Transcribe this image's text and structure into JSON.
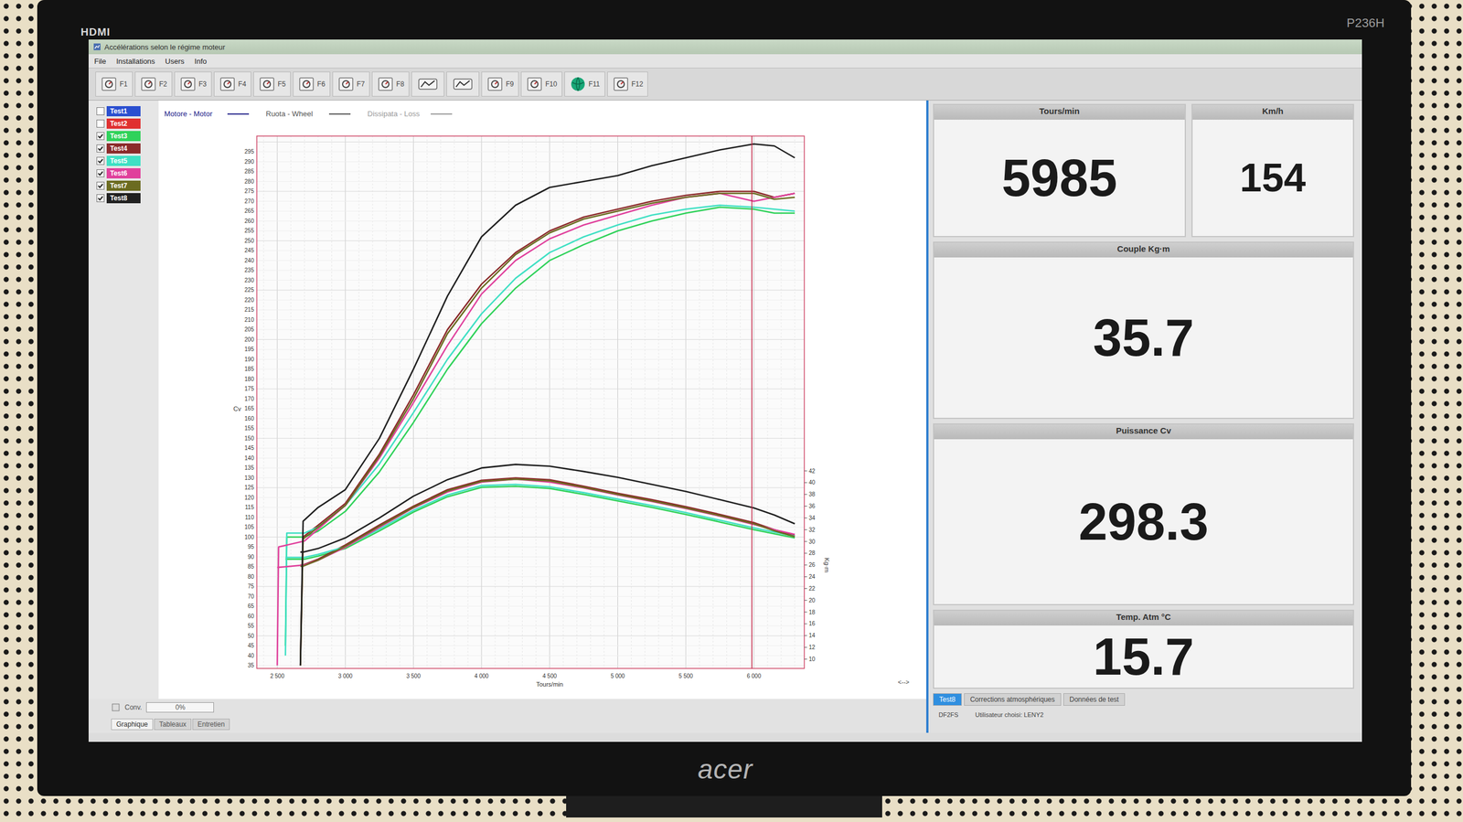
{
  "monitor": {
    "input": "HDMI",
    "model": "P236H",
    "brand": "acer"
  },
  "window": {
    "title": "Accélérations selon le régime moteur"
  },
  "menu": [
    "File",
    "Installations",
    "Users",
    "Info"
  ],
  "toolbar": [
    {
      "label": "F1",
      "kind": "labeled"
    },
    {
      "label": "F2",
      "kind": "labeled"
    },
    {
      "label": "F3",
      "kind": "labeled"
    },
    {
      "label": "F4",
      "kind": "labeled"
    },
    {
      "label": "F5",
      "kind": "labeled"
    },
    {
      "label": "F6",
      "kind": "labeled"
    },
    {
      "label": "F7",
      "kind": "labeled"
    },
    {
      "label": "F8",
      "kind": "labeled"
    },
    {
      "label": "",
      "kind": "icon"
    },
    {
      "label": "",
      "kind": "icon"
    },
    {
      "label": "F9",
      "kind": "labeled"
    },
    {
      "label": "F10",
      "kind": "labeled"
    },
    {
      "label": "F11",
      "kind": "globe"
    },
    {
      "label": "F12",
      "kind": "labeled"
    }
  ],
  "chart_legend": [
    {
      "label": "Motore - Motor",
      "color": "#23238a"
    },
    {
      "label": "Ruota - Wheel",
      "color": "#555555"
    },
    {
      "label": "Dissipata - Loss",
      "color": "#9a9a9a"
    }
  ],
  "tests": [
    {
      "label": "Test1",
      "checked": false,
      "color": "#2a4fd0",
      "rpm": [],
      "power": [],
      "torque": []
    },
    {
      "label": "Test2",
      "checked": false,
      "color": "#e03030",
      "rpm": [],
      "power": [],
      "torque": []
    },
    {
      "label": "Test3",
      "checked": true,
      "color": "#2fd25a",
      "rpm": [
        2560,
        2570,
        2700,
        2800,
        3000,
        3250,
        3500,
        3750,
        4000,
        4250,
        4500,
        4750,
        5000,
        5250,
        5500,
        5750,
        6000,
        6150,
        6300
      ],
      "power": [
        45,
        100,
        100,
        103,
        113,
        133,
        158,
        185,
        208,
        226,
        240,
        248,
        255,
        260,
        264,
        267,
        266,
        264,
        264
      ],
      "torque": [
        27,
        27,
        27,
        27.5,
        28.8,
        31.8,
        35,
        37.6,
        39.2,
        39.4,
        39,
        38,
        36.9,
        35.8,
        34.6,
        33.3,
        32,
        31.3,
        30.6
      ]
    },
    {
      "label": "Test4",
      "checked": true,
      "color": "#8b2a2a",
      "rpm": [
        2670,
        2690,
        2800,
        3000,
        3250,
        3500,
        3750,
        4000,
        4250,
        4500,
        4750,
        5000,
        5250,
        5500,
        5750,
        6000,
        6150,
        6300
      ],
      "power": [
        35,
        100,
        106,
        117,
        142,
        172,
        205,
        228,
        244,
        255,
        262,
        266,
        270,
        273,
        275,
        275,
        272,
        274
      ],
      "torque": [
        26,
        26,
        27,
        29.4,
        32.8,
        36,
        38.8,
        40.4,
        40.8,
        40.5,
        39.4,
        38.2,
        37.1,
        35.9,
        34.6,
        33.2,
        32,
        31
      ]
    },
    {
      "label": "Test5",
      "checked": true,
      "color": "#3fe0c4",
      "rpm": [
        2560,
        2570,
        2700,
        2800,
        3000,
        3250,
        3500,
        3750,
        4000,
        4250,
        4500,
        4750,
        5000,
        5250,
        5500,
        5750,
        6000,
        6150,
        6300
      ],
      "power": [
        40,
        102,
        102,
        105,
        116,
        137,
        163,
        190,
        213,
        231,
        244,
        252,
        258,
        263,
        266,
        268,
        267,
        266,
        265
      ],
      "torque": [
        27.3,
        27.3,
        27.3,
        27.8,
        29.1,
        32.1,
        35.3,
        37.9,
        39.5,
        39.7,
        39.3,
        38.3,
        37.2,
        36.1,
        34.9,
        33.6,
        32.3,
        31.6,
        30.9
      ]
    },
    {
      "label": "Test6",
      "checked": true,
      "color": "#e0409c",
      "rpm": [
        2500,
        2510,
        2700,
        2800,
        3000,
        3250,
        3500,
        3750,
        4000,
        4250,
        4500,
        4750,
        5000,
        5250,
        5500,
        5750,
        6000,
        6150,
        6300
      ],
      "power": [
        35,
        95,
        98,
        104,
        116,
        140,
        168,
        197,
        223,
        240,
        251,
        258,
        263,
        268,
        272,
        274,
        270,
        272,
        274
      ],
      "torque": [
        25.6,
        25.6,
        26,
        26.8,
        29,
        32.4,
        35.7,
        38.4,
        40.1,
        40.6,
        40.1,
        39.1,
        37.9,
        36.8,
        35.6,
        34.3,
        32.9,
        32,
        31.2
      ]
    },
    {
      "label": "Test7",
      "checked": true,
      "color": "#6b6b20",
      "rpm": [
        2670,
        2690,
        2800,
        3000,
        3250,
        3500,
        3750,
        4000,
        4250,
        4500,
        4750,
        5000,
        5250,
        5500,
        5750,
        6000,
        6150,
        6300
      ],
      "power": [
        35,
        99,
        105,
        116,
        141,
        170,
        203,
        226,
        243,
        254,
        261,
        265,
        269,
        272,
        274,
        274,
        271,
        272
      ],
      "torque": [
        25.8,
        25.8,
        26.8,
        29.2,
        32.6,
        35.8,
        38.6,
        40.2,
        40.6,
        40.3,
        39.2,
        38,
        36.9,
        35.7,
        34.4,
        33,
        31.8,
        30.8
      ]
    },
    {
      "label": "Test8",
      "checked": true,
      "color": "#202020",
      "rpm": [
        2670,
        2690,
        2800,
        3000,
        3250,
        3500,
        3750,
        4000,
        4250,
        4500,
        4750,
        5000,
        5250,
        5500,
        5750,
        6000,
        6150,
        6300
      ],
      "power": [
        35,
        108,
        115,
        124,
        150,
        185,
        222,
        252,
        268,
        277,
        280,
        283,
        288,
        292,
        296,
        299,
        298,
        292
      ],
      "torque": [
        28.2,
        28.2,
        28.8,
        30.6,
        34,
        37.7,
        40.5,
        42.5,
        43.1,
        42.8,
        41.9,
        40.9,
        39.7,
        38.5,
        37.1,
        35.7,
        34.5,
        33
      ]
    }
  ],
  "axes": {
    "power_label": "Cv",
    "power_ticks": [
      "295",
      "290",
      "285",
      "280",
      "275",
      "270",
      "265",
      "260",
      "255",
      "250",
      "245",
      "240",
      "235",
      "230",
      "225",
      "220",
      "215",
      "210",
      "205",
      "200",
      "195",
      "190",
      "185",
      "180",
      "175",
      "170",
      "165",
      "160",
      "155",
      "150",
      "145",
      "140",
      "135",
      "130",
      "125",
      "120",
      "115",
      "110",
      "105",
      "100",
      "95",
      "90",
      "85",
      "80",
      "75",
      "70",
      "65",
      "60",
      "55",
      "50",
      "45",
      "40",
      "35"
    ],
    "torque_label": "Kg·m",
    "torque_ticks": [
      "42",
      "40",
      "38",
      "36",
      "34",
      "32",
      "30",
      "28",
      "26",
      "24",
      "22",
      "20",
      "18",
      "16",
      "14",
      "12",
      "10"
    ],
    "rpm_label": "Tours/min",
    "rpm_ticks": [
      "2 500",
      "3 000",
      "3 500",
      "4 000",
      "4 500",
      "5 000",
      "5 500",
      "6 000"
    ]
  },
  "scroll": "<-->",
  "bottom_bar": {
    "conv_label": "Conv.",
    "conv_value": "0%",
    "tabs": [
      {
        "label": "Graphique",
        "selected": true
      },
      {
        "label": "Tableaux",
        "selected": false
      },
      {
        "label": "Entretien",
        "selected": false
      }
    ]
  },
  "readout_rows": [
    [
      {
        "title": "Tours/min",
        "value": "5985"
      },
      {
        "title": "Km/h",
        "value": "154"
      }
    ],
    [
      {
        "title": "Couple Kg·m",
        "value": "35.7"
      }
    ],
    [
      {
        "title": "Puissance Cv",
        "value": "298.3"
      }
    ],
    [
      {
        "title": "Temp. Atm °C",
        "value": "15.7"
      }
    ]
  ],
  "bottom_tabs": [
    {
      "label": "Test8",
      "selected": true
    },
    {
      "label": "Corrections atmosphériques",
      "selected": false
    },
    {
      "label": "Données de test",
      "selected": false
    }
  ],
  "status": [
    "DF2FS",
    "Utilisateur choisi: LENY2"
  ]
}
